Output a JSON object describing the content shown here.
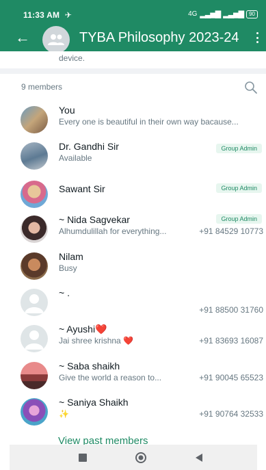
{
  "status_bar": {
    "time": "11:33 AM",
    "extra_icon": "vibe-icon",
    "network": "4G",
    "battery": "90"
  },
  "header": {
    "back_icon": "arrow-left-icon",
    "title": "TYBA Philosophy 2023-24",
    "menu_icon": "three-dots-vertical-icon"
  },
  "description": {
    "text": "device."
  },
  "members": {
    "count_label": "9 members",
    "search_icon": "search-icon",
    "items": [
      {
        "name": "You",
        "status": "Every one is beautiful in their own way bacause...",
        "phone": "",
        "badge": ""
      },
      {
        "name": "Dr. Gandhi Sir",
        "status": "Available",
        "phone": "",
        "badge": "Group Admin"
      },
      {
        "name": "Sawant Sir",
        "status": "",
        "phone": "",
        "badge": "Group Admin"
      },
      {
        "name": "~ Nida Sagvekar",
        "status": "Alhumdulillah for everything...",
        "phone": "+91 84529 10773",
        "badge": "Group Admin"
      },
      {
        "name": "Nilam",
        "status": "Busy",
        "phone": "",
        "badge": ""
      },
      {
        "name": "~ .",
        "status": "",
        "phone": "+91 88500 31760",
        "badge": ""
      },
      {
        "name": "~ Ayushi❤️",
        "status": "Jai shree krishna ❤️",
        "phone": "+91 83693 16087",
        "badge": ""
      },
      {
        "name": "~ Saba shaikh",
        "status": "Give the world a reason to...",
        "phone": "+91 90045 65523",
        "badge": ""
      },
      {
        "name": "~ Saniya Shaikh",
        "status": "✨",
        "phone": "+91 90764 32533",
        "badge": ""
      }
    ]
  },
  "view_past_members": "View past members",
  "nav": {
    "recents_icon": "square-icon",
    "home_icon": "circle-icon",
    "back_icon": "triangle-back-icon"
  },
  "colors": {
    "brand": "#1f8a64",
    "badge_bg": "#e7f6ef",
    "secondary_text": "#667781",
    "heart": "#e53935"
  }
}
